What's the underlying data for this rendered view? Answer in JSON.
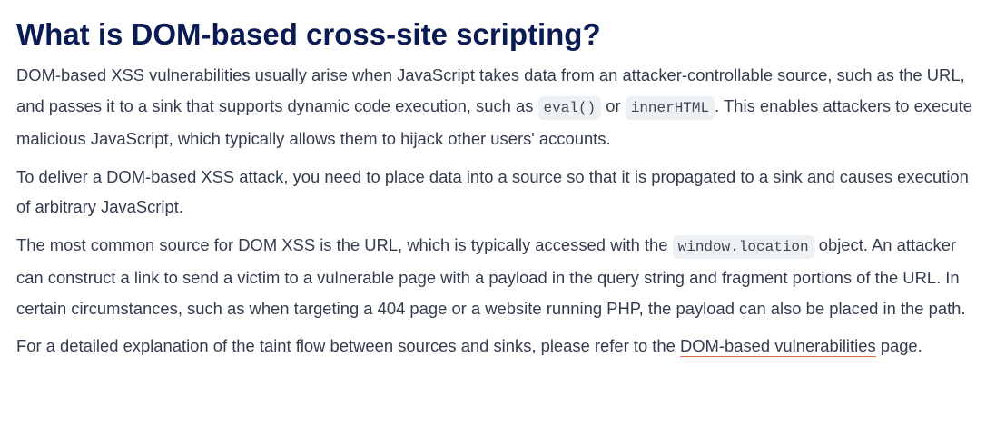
{
  "heading": "What is DOM-based cross-site scripting?",
  "p1": {
    "text_a": "DOM-based XSS vulnerabilities usually arise when JavaScript takes data from an attacker-controllable source, such as the URL, and passes it to a sink that supports dynamic code execution, such as ",
    "code_1": "eval()",
    "text_b": " or ",
    "code_2": "innerHTML",
    "text_c": ". This enables attackers to execute malicious JavaScript, which typically allows them to hijack other users' accounts."
  },
  "p2": {
    "text": "To deliver a DOM-based XSS attack, you need to place data into a source so that it is propagated to a sink and causes execution of arbitrary JavaScript."
  },
  "p3": {
    "text_a": "The most common source for DOM XSS is the URL, which is typically accessed with the ",
    "code_1": "window.location",
    "text_b": " object. An attacker can construct a link to send a victim to a vulnerable page with a payload in the query string and fragment portions of the URL. In certain circumstances, such as when targeting a 404 page or a website running PHP, the payload can also be placed in the path."
  },
  "p4": {
    "text_a": "For a detailed explanation of the taint flow between sources and sinks, please refer to the ",
    "link": "DOM-based vulnerabilities",
    "text_b": " page."
  },
  "colors": {
    "heading": "#0a1a54",
    "body_text": "#333c4e",
    "code_background": "#eef1f4",
    "link_underline": "#e8664e"
  }
}
